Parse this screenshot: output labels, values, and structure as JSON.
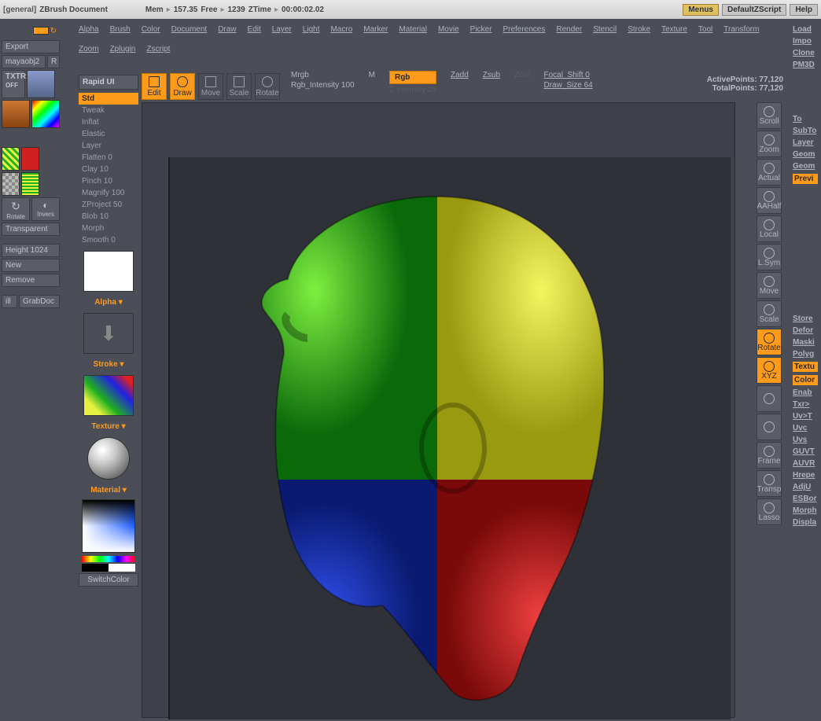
{
  "top": {
    "general": "[general]",
    "doc": "ZBrush Document",
    "mem": "Mem",
    "memv": "157.35",
    "free": "Free",
    "freev": "1239",
    "ztime": "ZTime",
    "ztimev": "00:00:02.02",
    "menus": "Menus",
    "defz": "DefaultZScript",
    "help": "Help"
  },
  "menu": [
    "Alpha",
    "Brush",
    "Color",
    "Document",
    "Draw",
    "Edit",
    "Layer",
    "Light",
    "Macro",
    "Marker",
    "Material",
    "Movie",
    "Picker",
    "Preferences",
    "Render",
    "Stencil",
    "Stroke",
    "Texture",
    "Tool",
    "Transform",
    "Zoom",
    "Zplugin",
    "Zscript"
  ],
  "left": {
    "export": "Export",
    "mayaobj": "mayaobj2",
    "r": "R",
    "txtr": "TXTR",
    "off": "OFF",
    "rotate": "Rotate",
    "invers": "Invers",
    "transp": "Transparent",
    "height": "Height 1024",
    "new": "New",
    "remove": "Remove",
    "ill": "ill",
    "grab": "GrabDoc"
  },
  "rapid": "Rapid UI",
  "brushes": [
    {
      "n": "Std",
      "a": true
    },
    {
      "n": "Tweak"
    },
    {
      "n": "Inflat"
    },
    {
      "n": "Elastic"
    },
    {
      "n": "Layer"
    },
    {
      "n": "Flatten 0"
    },
    {
      "n": "Clay 10"
    },
    {
      "n": "Pinch 10"
    },
    {
      "n": "Magnify 100"
    },
    {
      "n": "ZProject 50"
    },
    {
      "n": "Blob 10"
    },
    {
      "n": "Morph"
    },
    {
      "n": "Smooth 0"
    }
  ],
  "labels": {
    "alpha": "Alpha ▾",
    "stroke": "Stroke ▾",
    "texture": "Texture ▾",
    "material": "Material ▾",
    "switch": "SwitchColor"
  },
  "modes": {
    "edit": "Edit",
    "draw": "Draw",
    "move": "Move",
    "scale": "Scale",
    "rotate": "Rotate"
  },
  "params": {
    "mrgb": "Mrgb",
    "m": "M",
    "rgb": "Rgb",
    "zadd": "Zadd",
    "zsub": "Zsub",
    "zcut": "Zcut",
    "focal": "Focal_Shift 0",
    "rgbint": "Rgb_Intensity 100",
    "zint": "Z Intensity 25",
    "drawsize": "Draw_Size 64"
  },
  "stats": {
    "act": "ActivePoints: 77,120",
    "tot": "TotalPoints: 77,120"
  },
  "right": [
    "Scroll",
    "Zoom",
    "Actual",
    "AAHalf",
    "Local",
    "L.Sym",
    "Move",
    "Scale",
    "Rotate",
    "XYZ",
    "",
    "",
    "Frame",
    "Transp",
    "Lasso"
  ],
  "far": [
    "Load",
    "Impo",
    "Clone",
    "PM3D",
    "",
    "To",
    "SubTo",
    "Layer",
    "Geom",
    "Geom",
    "Previ",
    "",
    "",
    "",
    "Store",
    "Defor",
    "Maski",
    "Polyg",
    "Textu",
    "Color",
    "Enab",
    "Txr>",
    "Uv>T",
    "Uvc",
    "Uvs",
    "GUVT",
    "AUVR",
    "Hrepe",
    "AdjU",
    "ESBor",
    "Morph",
    "Displa"
  ]
}
